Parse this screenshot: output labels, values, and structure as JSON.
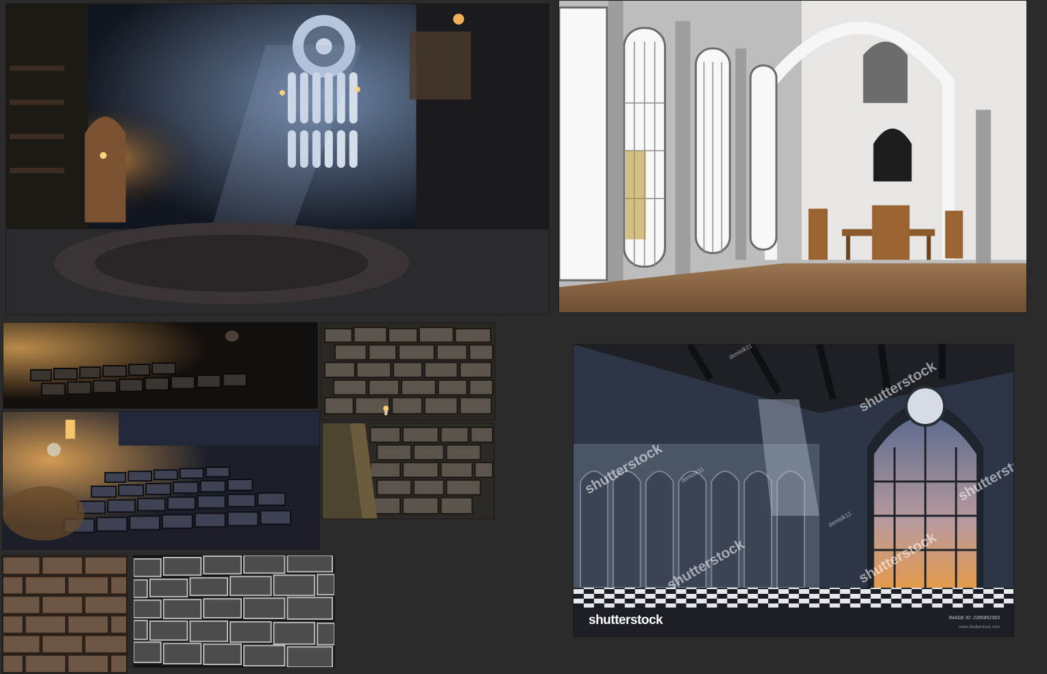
{
  "board": {
    "background": "#2b2b2b"
  },
  "references": [
    {
      "id": "library",
      "icon": "gothic-library-image"
    },
    {
      "id": "white-hall",
      "icon": "white-gothic-hall-image"
    },
    {
      "id": "cobble-dark",
      "icon": "cobblestone-floor-image"
    },
    {
      "id": "stone-wall-candle",
      "icon": "stone-wall-image"
    },
    {
      "id": "cobble-lantern",
      "icon": "cobblestone-lantern-image"
    },
    {
      "id": "stone-wall-corner",
      "icon": "stone-wall-image"
    },
    {
      "id": "brick-brown",
      "icon": "brick-texture-image"
    },
    {
      "id": "brick-grey",
      "icon": "brick-texture-image"
    },
    {
      "id": "stock-hall",
      "icon": "gothic-hall-stock-image"
    }
  ],
  "stock": {
    "logo": "shutterstock",
    "image_id": "IMAGE ID: 2285852303",
    "url": "www.shutterstock.com",
    "watermark": "shutterstock",
    "contributor": "denisik11"
  }
}
